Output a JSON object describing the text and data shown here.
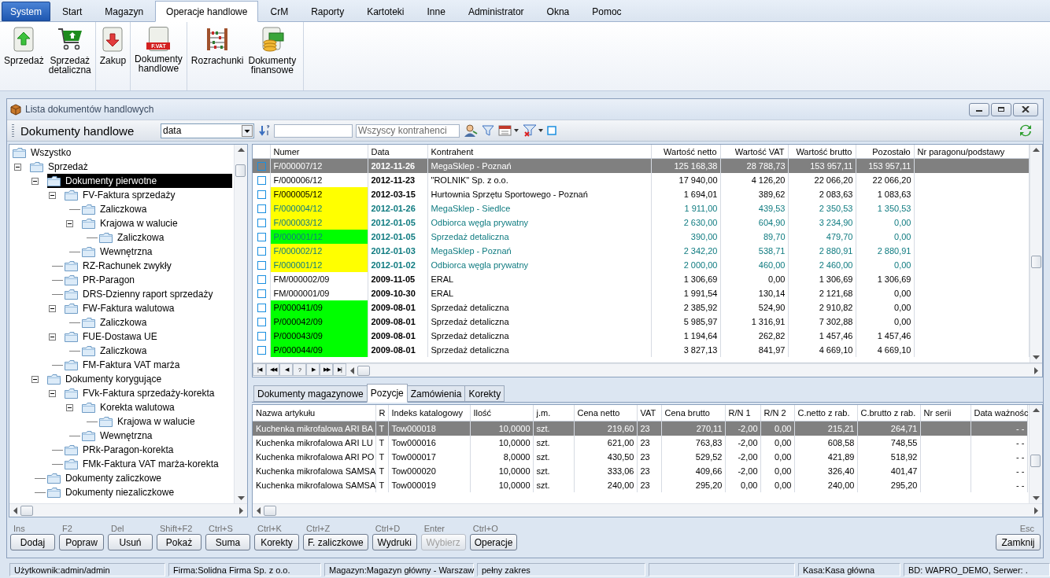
{
  "menu_tabs": [
    {
      "label": "System",
      "kind": "app",
      "selected": false
    },
    {
      "label": "Start",
      "kind": "tab",
      "selected": false
    },
    {
      "label": "Magazyn",
      "kind": "tab",
      "selected": false
    },
    {
      "label": "Operacje handlowe",
      "kind": "tab",
      "selected": true
    },
    {
      "label": "CrM",
      "kind": "tab",
      "selected": false
    },
    {
      "label": "Raporty",
      "kind": "tab",
      "selected": false
    },
    {
      "label": "Kartoteki",
      "kind": "tab",
      "selected": false
    },
    {
      "label": "Inne",
      "kind": "tab",
      "selected": false
    },
    {
      "label": "Administrator",
      "kind": "tab",
      "selected": false
    },
    {
      "label": "Okna",
      "kind": "tab",
      "selected": false
    },
    {
      "label": "Pomoc",
      "kind": "tab",
      "selected": false
    }
  ],
  "ribbon": [
    {
      "buttons": [
        {
          "kind": "sale",
          "lines": [
            "Sprzedaż"
          ]
        },
        {
          "kind": "retail",
          "lines": [
            "Sprzedaż",
            "detaliczna"
          ]
        }
      ]
    },
    {
      "buttons": [
        {
          "kind": "purchase",
          "lines": [
            "Zakup"
          ]
        }
      ]
    },
    {
      "buttons": [
        {
          "kind": "invoice",
          "badge": "F.VAT",
          "lines": [
            "Dokumenty",
            "handlowe"
          ]
        }
      ]
    },
    {
      "buttons": [
        {
          "kind": "abacus",
          "lines": [
            "Rozrachunki"
          ]
        },
        {
          "kind": "money",
          "lines": [
            "Dokumenty",
            "finansowe"
          ]
        }
      ]
    }
  ],
  "window": {
    "title": "Lista dokumentów handlowych"
  },
  "toolbar": {
    "heading": "Dokumenty handlowe",
    "sort_select": {
      "value": "data"
    },
    "contractor_field": {
      "placeholder": "Wszyscy kontrahenci"
    }
  },
  "tree": [
    {
      "label": "Wszystko",
      "expanded": false,
      "selected": false
    },
    {
      "label": "Sprzedaż",
      "expanded": true,
      "selected": false,
      "children": [
        {
          "label": "Dokumenty pierwotne",
          "expanded": true,
          "selected": true,
          "children": [
            {
              "label": "FV-Faktura sprzedaży",
              "expanded": true,
              "selected": false,
              "children": [
                {
                  "label": "Zaliczkowa",
                  "expanded": false,
                  "selected": false
                },
                {
                  "label": "Krajowa w walucie",
                  "expanded": true,
                  "selected": false,
                  "children": [
                    {
                      "label": "Zaliczkowa",
                      "expanded": false,
                      "selected": false
                    }
                  ]
                },
                {
                  "label": "Wewnętrzna",
                  "expanded": false,
                  "selected": false
                }
              ]
            },
            {
              "label": "RZ-Rachunek zwykły",
              "expanded": false,
              "selected": false
            },
            {
              "label": "PR-Paragon",
              "expanded": false,
              "selected": false
            },
            {
              "label": "DRS-Dzienny raport sprzedaży",
              "expanded": false,
              "selected": false
            },
            {
              "label": "FW-Faktura walutowa",
              "expanded": true,
              "selected": false,
              "children": [
                {
                  "label": "Zaliczkowa",
                  "expanded": false,
                  "selected": false
                }
              ]
            },
            {
              "label": "FUE-Dostawa UE",
              "expanded": true,
              "selected": false,
              "children": [
                {
                  "label": "Zaliczkowa",
                  "expanded": false,
                  "selected": false
                }
              ]
            },
            {
              "label": "FM-Faktura VAT marża",
              "expanded": false,
              "selected": false
            }
          ]
        },
        {
          "label": "Dokumenty korygujące",
          "expanded": true,
          "selected": false,
          "children": [
            {
              "label": "FVk-Faktura sprzedaży-korekta",
              "expanded": true,
              "selected": false,
              "children": [
                {
                  "label": "Korekta walutowa",
                  "expanded": true,
                  "selected": false,
                  "children": [
                    {
                      "label": "Krajowa w walucie",
                      "expanded": false,
                      "selected": false
                    }
                  ]
                },
                {
                  "label": "Wewnętrzna",
                  "expanded": false,
                  "selected": false
                }
              ]
            },
            {
              "label": "PRk-Paragon-korekta",
              "expanded": false,
              "selected": false
            },
            {
              "label": "FMk-Faktura VAT marża-korekta",
              "expanded": false,
              "selected": false
            }
          ]
        },
        {
          "label": "Dokumenty zaliczkowe",
          "expanded": false,
          "selected": false
        },
        {
          "label": "Dokumenty niezaliczkowe",
          "expanded": false,
          "selected": false
        }
      ]
    }
  ],
  "documents": {
    "columns": [
      "Numer",
      "Data",
      "Kontrahent",
      "Wartość netto",
      "Wartość VAT",
      "Wartość brutto",
      "Pozostało",
      "Nr paragonu/podstawy"
    ],
    "rows": [
      {
        "checked": false,
        "selected": true,
        "marked": false,
        "numer": "F/000007/12",
        "data": "2012-11-26",
        "kontrahent": "MegaSklep - Poznań",
        "netto": "125 168,38",
        "vat": "28 788,73",
        "brutto": "153 957,11",
        "pozostalo": "153 957,11"
      },
      {
        "checked": false,
        "selected": false,
        "marked": false,
        "numer": "F/000006/12",
        "data": "2012-11-23",
        "kontrahent": "\"ROLNIK\" Sp. z o.o.",
        "netto": "17 940,00",
        "vat": "4 126,20",
        "brutto": "22 066,20",
        "pozostalo": "22 066,20"
      },
      {
        "checked": false,
        "selected": false,
        "marked": false,
        "color": "#ffff00",
        "numer": "F/000005/12",
        "data": "2012-03-15",
        "kontrahent": "Hurtownia Sprzętu Sportowego - Poznań",
        "netto": "1 694,01",
        "vat": "389,62",
        "brutto": "2 083,63",
        "pozostalo": "1 083,63"
      },
      {
        "checked": false,
        "selected": false,
        "marked": true,
        "color": "#ffff00",
        "numer": "F/000004/12",
        "data": "2012-01-26",
        "kontrahent": "MegaSklep - Siedlce",
        "netto": "1 911,00",
        "vat": "439,53",
        "brutto": "2 350,53",
        "pozostalo": "1 350,53"
      },
      {
        "checked": false,
        "selected": false,
        "marked": true,
        "color": "#ffff00",
        "numer": "F/000003/12",
        "data": "2012-01-05",
        "kontrahent": "Odbiorca węgla prywatny",
        "netto": "2 630,00",
        "vat": "604,90",
        "brutto": "3 234,90",
        "pozostalo": "0,00"
      },
      {
        "checked": false,
        "selected": false,
        "marked": true,
        "color": "#00ff00",
        "numer": "P/000001/12",
        "data": "2012-01-05",
        "kontrahent": "Sprzedaż detaliczna",
        "netto": "390,00",
        "vat": "89,70",
        "brutto": "479,70",
        "pozostalo": "0,00"
      },
      {
        "checked": false,
        "selected": false,
        "marked": true,
        "color": "#ffff00",
        "numer": "F/000002/12",
        "data": "2012-01-03",
        "kontrahent": "MegaSklep - Poznań",
        "netto": "2 342,20",
        "vat": "538,71",
        "brutto": "2 880,91",
        "pozostalo": "2 880,91"
      },
      {
        "checked": false,
        "selected": false,
        "marked": true,
        "color": "#ffff00",
        "numer": "F/000001/12",
        "data": "2012-01-02",
        "kontrahent": "Odbiorca węgla prywatny",
        "netto": "2 000,00",
        "vat": "460,00",
        "brutto": "2 460,00",
        "pozostalo": "0,00"
      },
      {
        "checked": false,
        "selected": false,
        "marked": false,
        "numer": "FM/000002/09",
        "data": "2009-11-05",
        "kontrahent": "ERAL",
        "netto": "1 306,69",
        "vat": "0,00",
        "brutto": "1 306,69",
        "pozostalo": "1 306,69"
      },
      {
        "checked": false,
        "selected": false,
        "marked": false,
        "numer": "FM/000001/09",
        "data": "2009-10-30",
        "kontrahent": "ERAL",
        "netto": "1 991,54",
        "vat": "130,14",
        "brutto": "2 121,68",
        "pozostalo": "0,00"
      },
      {
        "checked": false,
        "selected": false,
        "marked": false,
        "color": "#00ff00",
        "numer": "P/000041/09",
        "data": "2009-08-01",
        "kontrahent": "Sprzedaż detaliczna",
        "netto": "2 385,92",
        "vat": "524,90",
        "brutto": "2 910,82",
        "pozostalo": "0,00"
      },
      {
        "checked": false,
        "selected": false,
        "marked": false,
        "color": "#00ff00",
        "numer": "P/000042/09",
        "data": "2009-08-01",
        "kontrahent": "Sprzedaż detaliczna",
        "netto": "5 985,97",
        "vat": "1 316,91",
        "brutto": "7 302,88",
        "pozostalo": "0,00"
      },
      {
        "checked": false,
        "selected": false,
        "marked": false,
        "color": "#00ff00",
        "numer": "P/000043/09",
        "data": "2009-08-01",
        "kontrahent": "Sprzedaż detaliczna",
        "netto": "1 194,64",
        "vat": "262,82",
        "brutto": "1 457,46",
        "pozostalo": "1 457,46"
      },
      {
        "checked": false,
        "selected": false,
        "marked": false,
        "color": "#00ff00",
        "numer": "P/000044/09",
        "data": "2009-08-01",
        "kontrahent": "Sprzedaż detaliczna",
        "netto": "3 827,13",
        "vat": "841,97",
        "brutto": "4 669,10",
        "pozostalo": "4 669,10"
      }
    ],
    "navigator": [
      "|◀",
      "◀◀",
      "◀",
      "?",
      "▶",
      "▶▶",
      "▶|"
    ]
  },
  "detail_tabs": [
    {
      "label": "Dokumenty magazynowe",
      "selected": false
    },
    {
      "label": "Pozycje",
      "selected": true
    },
    {
      "label": "Zamówienia",
      "selected": false
    },
    {
      "label": "Korekty",
      "selected": false
    }
  ],
  "positions": {
    "columns": [
      "Nazwa artykułu",
      "R",
      "Indeks katalogowy",
      "Ilość",
      "j.m.",
      "Cena netto",
      "VAT",
      "Cena brutto",
      "R/N 1",
      "R/N 2",
      "C.netto z rab.",
      "C.brutto z rab.",
      "Nr serii",
      "Data ważnośc"
    ],
    "rows": [
      {
        "selected": true,
        "name": "Kuchenka mikrofalowa ARI BA",
        "r": "T",
        "index": "Tow000018",
        "qty": "10,0000",
        "unit": "szt.",
        "net": "219,60",
        "vat": "23",
        "gross": "270,11",
        "rn1": "-2,00",
        "rn2": "0,00",
        "net_disc": "215,21",
        "gross_disc": "264,71",
        "expiry": "- -"
      },
      {
        "selected": false,
        "name": "Kuchenka mikrofalowa ARI LU",
        "r": "T",
        "index": "Tow000016",
        "qty": "10,0000",
        "unit": "szt.",
        "net": "621,00",
        "vat": "23",
        "gross": "763,83",
        "rn1": "-2,00",
        "rn2": "0,00",
        "net_disc": "608,58",
        "gross_disc": "748,55",
        "expiry": "- -"
      },
      {
        "selected": false,
        "name": "Kuchenka mikrofalowa ARI PO",
        "r": "T",
        "index": "Tow000017",
        "qty": "8,0000",
        "unit": "szt.",
        "net": "430,50",
        "vat": "23",
        "gross": "529,52",
        "rn1": "-2,00",
        "rn2": "0,00",
        "net_disc": "421,89",
        "gross_disc": "518,92",
        "expiry": "- -"
      },
      {
        "selected": false,
        "name": "Kuchenka mikrofalowa SAMSA",
        "r": "T",
        "index": "Tow000020",
        "qty": "10,0000",
        "unit": "szt.",
        "net": "333,06",
        "vat": "23",
        "gross": "409,66",
        "rn1": "-2,00",
        "rn2": "0,00",
        "net_disc": "326,40",
        "gross_disc": "401,47",
        "expiry": "- -"
      },
      {
        "selected": false,
        "name": "Kuchenka mikrofalowa SAMSA",
        "r": "T",
        "index": "Tow000019",
        "qty": "10,0000",
        "unit": "szt.",
        "net": "240,00",
        "vat": "23",
        "gross": "295,20",
        "rn1": "0,00",
        "rn2": "0,00",
        "net_disc": "240,00",
        "gross_disc": "295,20",
        "expiry": "- -"
      }
    ]
  },
  "actions": [
    {
      "shortcut": "Ins",
      "label": "Dodaj",
      "disabled": false
    },
    {
      "shortcut": "F2",
      "label": "Popraw",
      "disabled": false
    },
    {
      "shortcut": "Del",
      "label": "Usuń",
      "disabled": false
    },
    {
      "shortcut": "Shift+F2",
      "label": "Pokaż",
      "disabled": false
    },
    {
      "shortcut": "Ctrl+S",
      "label": "Suma",
      "disabled": false
    },
    {
      "shortcut": "Ctrl+K",
      "label": "Korekty",
      "disabled": false
    },
    {
      "shortcut": "Ctrl+Z",
      "label": "F. zaliczkowe",
      "disabled": false
    },
    {
      "shortcut": "Ctrl+D",
      "label": "Wydruki",
      "disabled": false
    },
    {
      "shortcut": "Enter",
      "label": "Wybierz",
      "disabled": true
    },
    {
      "shortcut": "Ctrl+O",
      "label": "Operacje",
      "disabled": false
    }
  ],
  "close_action": {
    "shortcut": "Esc",
    "label": "Zamknij"
  },
  "status_bar": [
    "Użytkownik:admin/admin",
    "Firma:Solidna Firma Sp. z o.o.",
    "Magazyn:Magazyn główny - Warszaw",
    "pełny zakres",
    "Kasa:Kasa główna",
    "BD: WAPRO_DEMO, Serwer: ."
  ]
}
